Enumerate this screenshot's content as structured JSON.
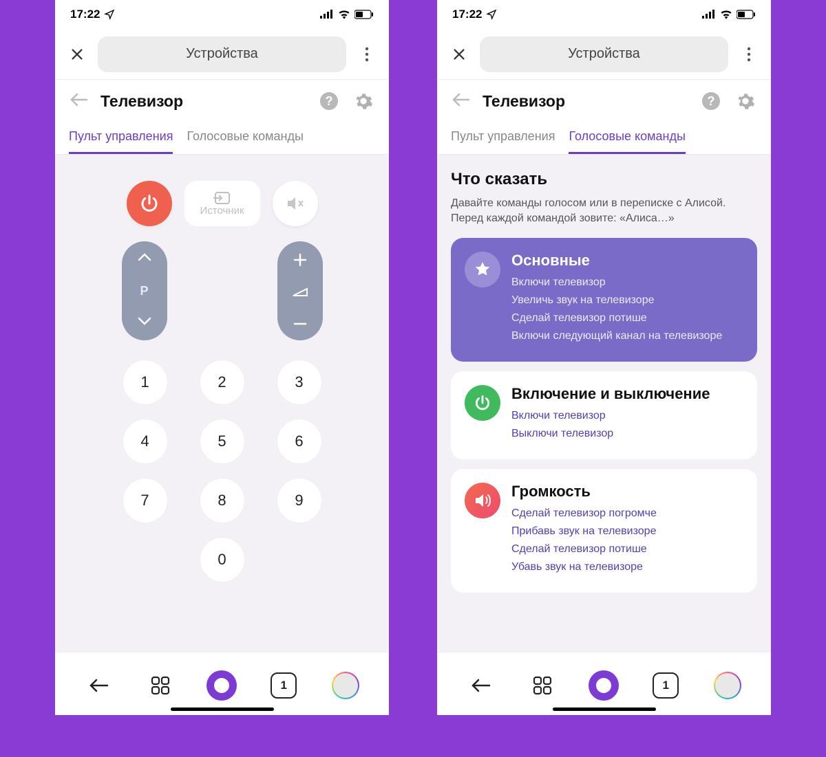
{
  "status": {
    "time": "17:22"
  },
  "header": {
    "title": "Устройства"
  },
  "device": {
    "title": "Телевизор"
  },
  "tabs": {
    "remote": "Пульт управления",
    "voice": "Голосовые команды"
  },
  "remote": {
    "source_label": "Источник",
    "channel_label": "P",
    "numpad": [
      "1",
      "2",
      "3",
      "4",
      "5",
      "6",
      "7",
      "8",
      "9",
      "0"
    ]
  },
  "voice": {
    "heading": "Что сказать",
    "subtext": "Давайте команды голосом или в переписке с Алисой. Перед каждой командой зовите: «Алиса…»",
    "groups": [
      {
        "title": "Основные",
        "items": [
          "Включи телевизор",
          "Увеличь звук на телевизоре",
          "Сделай телевизор потише",
          "Включи следующий канал на телевизоре"
        ]
      },
      {
        "title": "Включение и выключение",
        "items": [
          "Включи телевизор",
          "Выключи телевизор"
        ]
      },
      {
        "title": "Громкость",
        "items": [
          "Сделай телевизор погромче",
          "Прибавь звук на телевизоре",
          "Сделай телевизор потише",
          "Убавь звук на телевизоре"
        ]
      }
    ]
  },
  "nav": {
    "tab_count": "1"
  }
}
